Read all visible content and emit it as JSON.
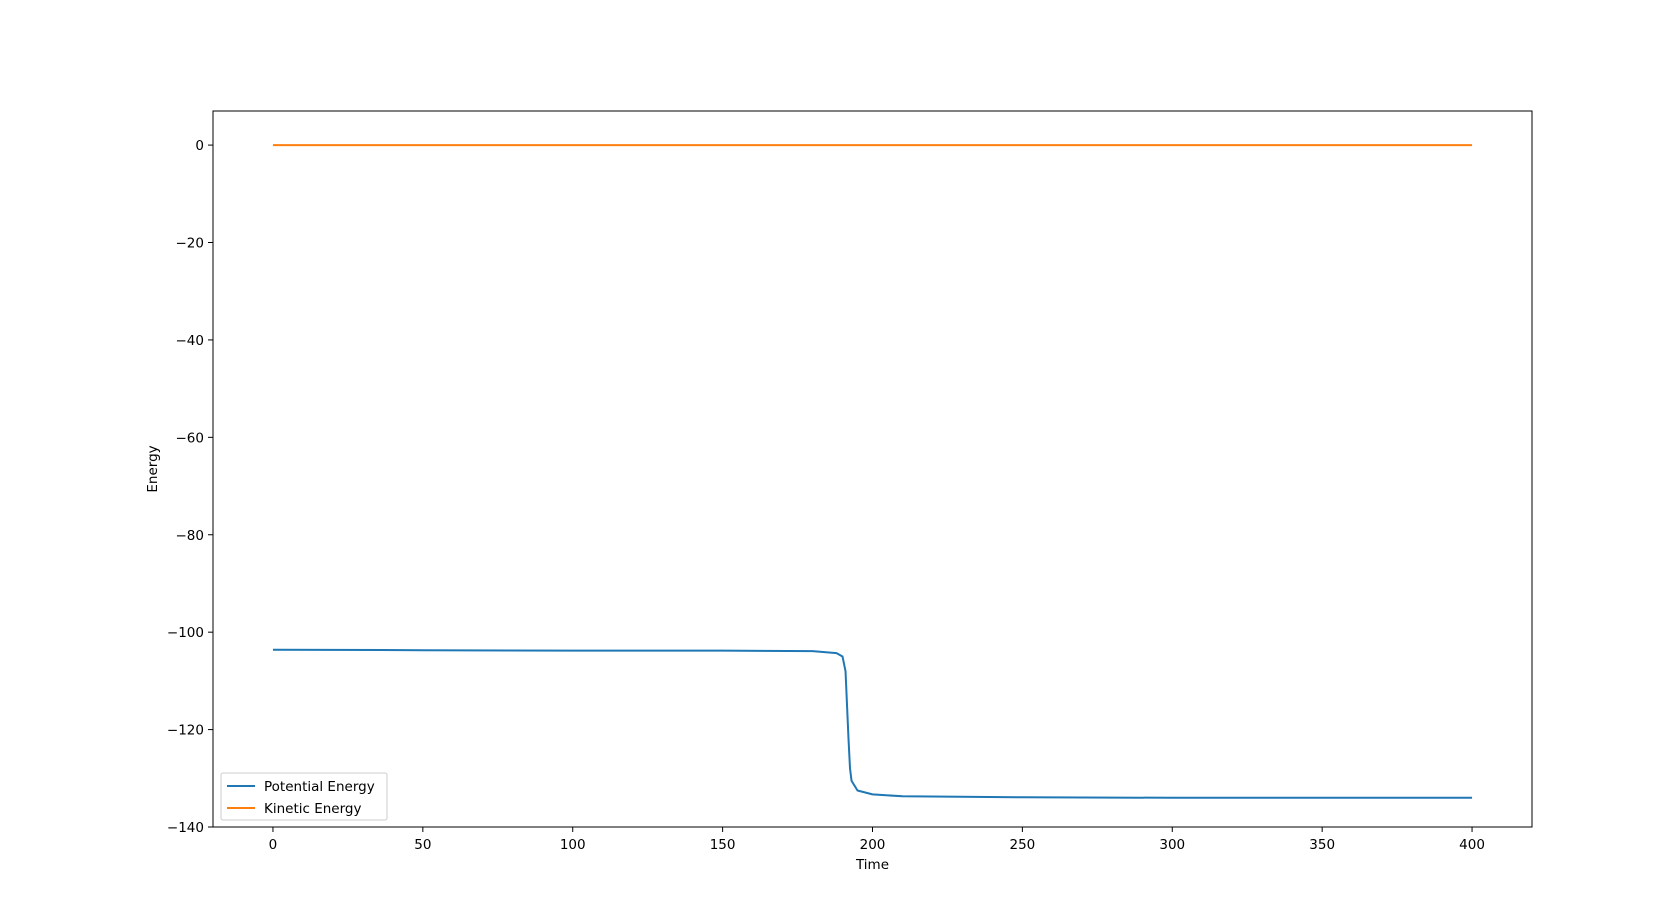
{
  "chart_data": {
    "type": "line",
    "title": "",
    "xlabel": "Time",
    "ylabel": "Energy",
    "xlim": [
      -20,
      420
    ],
    "ylim": [
      -140,
      7
    ],
    "x_ticks": [
      0,
      50,
      100,
      150,
      200,
      250,
      300,
      350,
      400
    ],
    "y_ticks": [
      0,
      -20,
      -40,
      -60,
      -80,
      -100,
      -120,
      -140
    ],
    "grid": false,
    "legend_position": "lower-left",
    "series": [
      {
        "name": "Potential Energy",
        "color": "#1f77b4",
        "x": [
          0,
          50,
          100,
          150,
          180,
          188,
          190,
          191,
          191.5,
          192,
          192.5,
          193,
          195,
          200,
          210,
          250,
          300,
          350,
          400
        ],
        "y": [
          -103.6,
          -103.7,
          -103.8,
          -103.8,
          -103.9,
          -104.3,
          -105.0,
          -108,
          -115,
          -122,
          -128,
          -130.5,
          -132.5,
          -133.3,
          -133.7,
          -133.9,
          -134.0,
          -134.0,
          -134.0
        ]
      },
      {
        "name": "Kinetic Energy",
        "color": "#ff7f0e",
        "x": [
          0,
          400
        ],
        "y": [
          0,
          0
        ]
      }
    ]
  }
}
